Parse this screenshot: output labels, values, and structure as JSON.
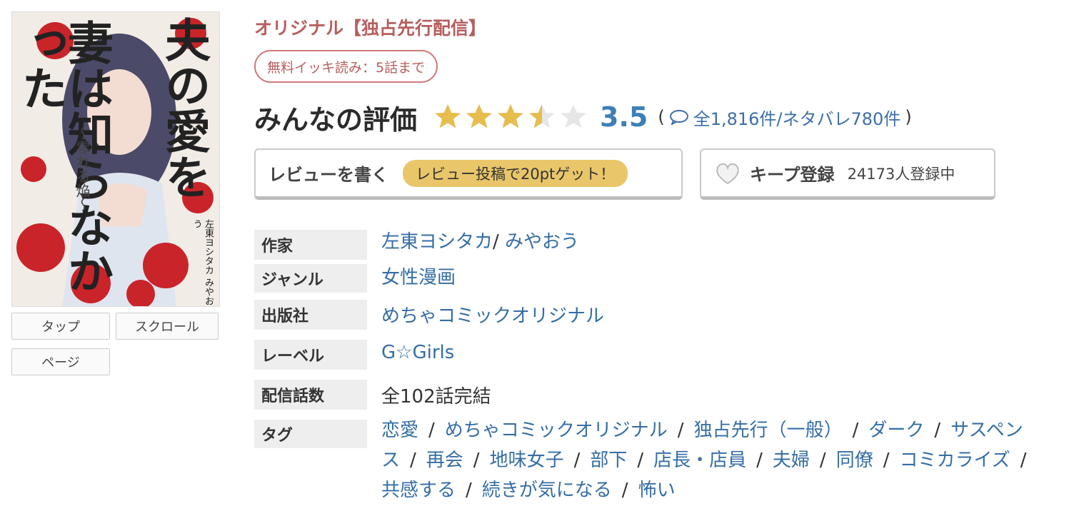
{
  "cover": {
    "title_right": "夫の愛を",
    "title_left": "妻は知らなかった",
    "subtitle": "〜零れる焔〜",
    "authors": "左東ヨシタカ みやおう"
  },
  "view_buttons": {
    "tap": "タップ",
    "scroll": "スクロール",
    "page": "ページ"
  },
  "header": {
    "category": "オリジナル【独占先行配信】",
    "free_badge": "無料イッキ読み：5話まで"
  },
  "rating": {
    "title": "みんなの評価",
    "score": "3.5",
    "value": 3.5,
    "max": 5,
    "open_paren": "(",
    "reviews": "全1,816件/ネタバレ780件",
    "close_paren": ")",
    "star_color": "#e6bd4e",
    "empty_star_color": "#e6e6e6"
  },
  "review_button": {
    "label": "レビューを書く",
    "badge": "レビュー投稿で20ptゲット！"
  },
  "keep_button": {
    "label": "キープ登録",
    "count": "24173人登録中"
  },
  "info": {
    "author_label": "作家",
    "authors": [
      "左東ヨシタカ",
      "みやおう"
    ],
    "author_sep": "/",
    "genre_label": "ジャンル",
    "genre": "女性漫画",
    "publisher_label": "出版社",
    "publisher": "めちゃコミックオリジナル",
    "label_label": "レーベル",
    "label": "G☆Girls",
    "episodes_label": "配信話数",
    "episodes": "全102話完結",
    "tags_label": "タグ",
    "tags": [
      "恋愛",
      "めちゃコミックオリジナル",
      "独占先行（一般）",
      "ダーク",
      "サスペンス",
      "再会",
      "地味女子",
      "部下",
      "店長・店員",
      "夫婦",
      "同僚",
      "コミカライズ",
      "共感する",
      "続きが気になる",
      "怖い"
    ],
    "tag_sep": "/"
  }
}
